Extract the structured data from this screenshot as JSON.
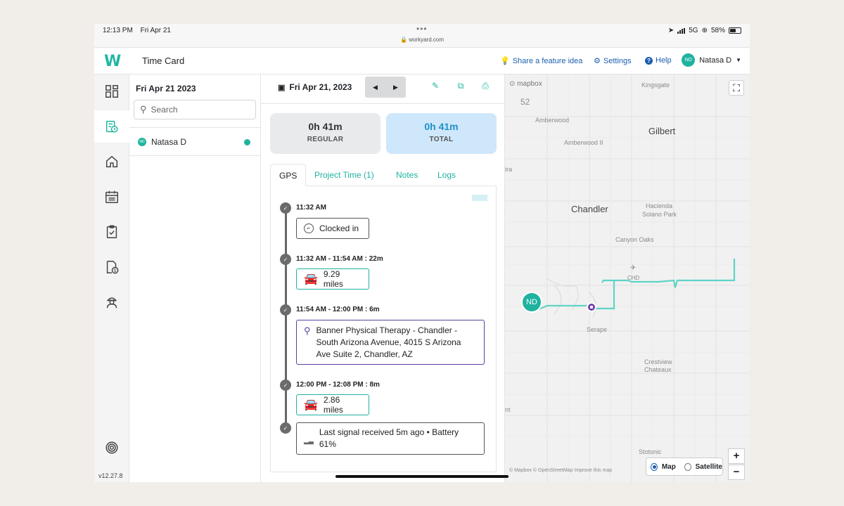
{
  "status_bar": {
    "time": "12:13 PM",
    "date": "Fri Apr 21",
    "url": "workyard.com",
    "network": "5G",
    "battery": "58%"
  },
  "header": {
    "logo": "W",
    "title": "Time Card",
    "feature_link": "Share a feature idea",
    "settings_link": "Settings",
    "help_link": "Help",
    "user_initials": "ND",
    "user_name": "Natasa D"
  },
  "sidebar": {
    "icons": [
      "dashboard-icon",
      "timecard-icon",
      "home-icon",
      "calendar-icon",
      "checklist-icon",
      "expense-icon",
      "worker-icon"
    ],
    "settings_icon": "settings-icon",
    "version": "v12.27.8"
  },
  "people_panel": {
    "date": "Fri Apr 21 2023",
    "search_placeholder": "Search",
    "people": [
      {
        "initials": "ND",
        "name": "Natasa D",
        "status_color": "#1fb39f"
      }
    ]
  },
  "main": {
    "date": "Fri Apr 21, 2023",
    "summary": {
      "regular": {
        "value": "0h 41m",
        "label": "REGULAR"
      },
      "total": {
        "value": "0h 41m",
        "label": "TOTAL"
      }
    },
    "tabs": [
      "GPS",
      "Project Time (1)",
      "Notes",
      "Logs"
    ],
    "active_tab": "GPS",
    "timeline": [
      {
        "time": "11:32 AM",
        "label": "Clocked in",
        "kind": "clock"
      },
      {
        "time": "11:32 AM - 11:54 AM : 22m",
        "label": "9.29 miles",
        "kind": "drive"
      },
      {
        "time": "11:54 AM - 12:00 PM : 6m",
        "label": "Banner Physical Therapy - Chandler - South Arizona Avenue, 4015 S Arizona Ave Suite 2, Chandler, AZ",
        "kind": "place"
      },
      {
        "time": "12:00 PM - 12:08 PM : 8m",
        "label": "2.86 miles",
        "kind": "drive"
      },
      {
        "time": "",
        "label": "Last signal received 5m ago • Battery 61%",
        "kind": "signal"
      }
    ]
  },
  "map": {
    "provider_logo": "mapbox",
    "labels": {
      "kingsgate": "Kingsgate",
      "amberwood": "Amberwood",
      "amberwood_ii": "Amberwood II",
      "gilbert": "Gilbert",
      "chandler": "Chandler",
      "hacienda": "Hacienda",
      "solano_park": "Solano Park",
      "canyon_oaks": "Canyon Oaks",
      "chd": "CHD",
      "serape": "Serape",
      "crestview": "Crestview",
      "chateaux": "Chateaux",
      "stotonic": "Stotonic",
      "edge_fragment_1": "ira",
      "edge_fragment_2": "nt",
      "route_marker": "52"
    },
    "avatar_initials": "ND",
    "layer_options": [
      "Map",
      "Satellite"
    ],
    "selected_layer": "Map",
    "attribution": "© Mapbox © OpenStreetMap Improve this map",
    "route_color": "#5fd3c6"
  },
  "colors": {
    "accent": "#1fb39f",
    "link": "#1c5fb0",
    "total_bg": "#cfe7fa",
    "place_border": "#5a3ea0"
  }
}
